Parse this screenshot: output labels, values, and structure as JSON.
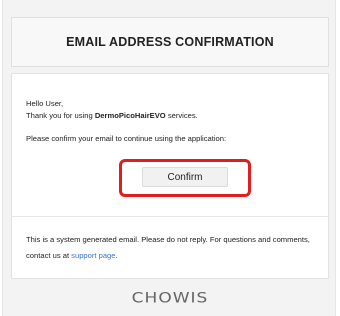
{
  "header": {
    "title": "EMAIL ADDRESS CONFIRMATION"
  },
  "body": {
    "greeting": "Hello User,",
    "thanks_prefix": "Thank you for using ",
    "brand": "DermoPicoHairEVO",
    "thanks_suffix": " services.",
    "prompt": "Please confirm your email to continue using the application:",
    "confirm_label": "Confirm",
    "note_text": "This is a system generated email. Please do not reply. For questions and comments, contact us at ",
    "note_link": "support page",
    "note_end": "."
  },
  "footer": {
    "logo_text": "CHOWIS"
  },
  "colors": {
    "highlight_border": "#e01e1e",
    "link": "#3a74c9"
  }
}
